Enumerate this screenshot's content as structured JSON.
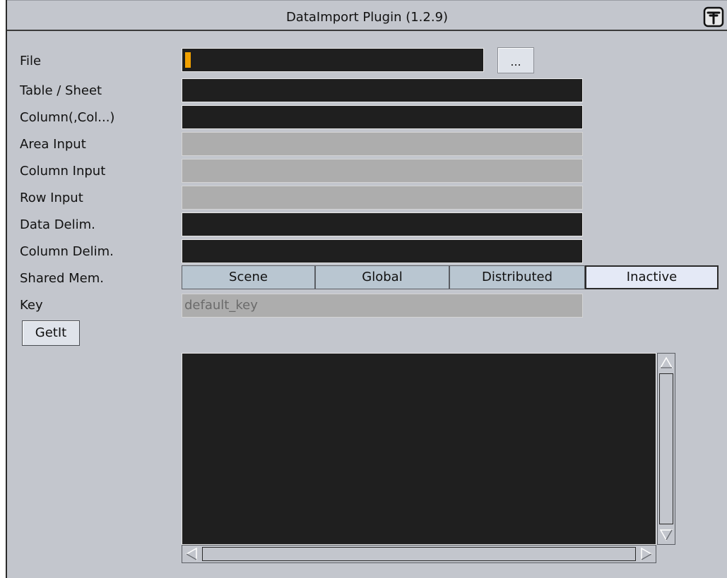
{
  "window": {
    "title": "DataImport Plugin (1.2.9)",
    "icon": "plugin-icon"
  },
  "form": {
    "file_label": "File",
    "file_value": "",
    "browse_label": "...",
    "table_label": "Table / Sheet",
    "column_label": "Column(,Col...)",
    "area_input_label": "Area Input",
    "column_input_label": "Column Input",
    "row_input_label": "Row Input",
    "data_delim_label": "Data Delim.",
    "column_delim_label": "Column Delim.",
    "shared_mem_label": "Shared Mem.",
    "shared_mem_options": [
      "Scene",
      "Global",
      "Distributed",
      "Inactive"
    ],
    "shared_mem_selected": "Inactive",
    "key_label": "Key",
    "key_placeholder": "default_key",
    "getit_label": "GetIt"
  },
  "colors": {
    "panel_bg": "#c3c6cd",
    "field_dark": "#1f1f1f",
    "field_disabled": "#adadad",
    "cursor": "#f0a000",
    "segment": "#b9c6d1",
    "segment_active": "#e4e9f6"
  }
}
